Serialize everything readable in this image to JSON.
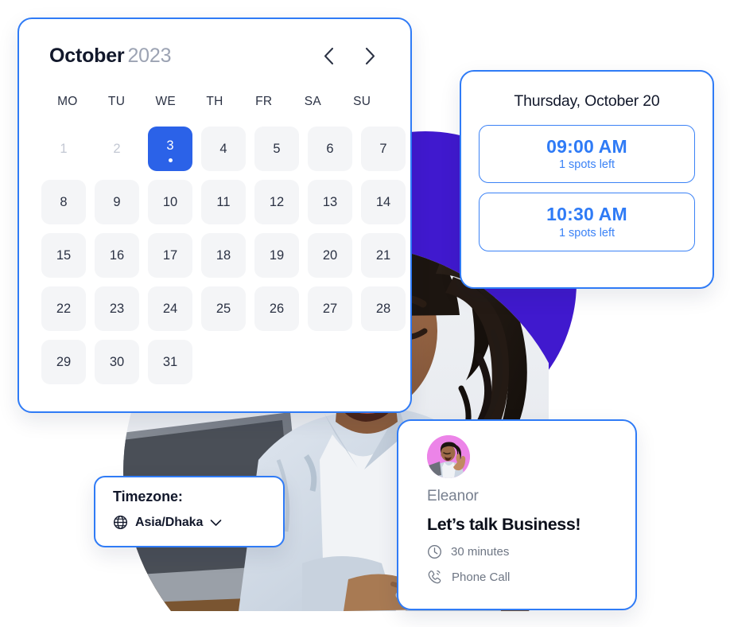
{
  "calendar": {
    "month": "October",
    "year": "2023",
    "prev_label": "chevron-left",
    "next_label": "chevron-right",
    "weekdays": [
      "MO",
      "TU",
      "WE",
      "TH",
      "FR",
      "SA",
      "SU"
    ],
    "days": [
      {
        "n": "1",
        "state": "muted"
      },
      {
        "n": "2",
        "state": "muted"
      },
      {
        "n": "3",
        "state": "selected",
        "dot": true
      },
      {
        "n": "4",
        "state": "normal"
      },
      {
        "n": "5",
        "state": "normal"
      },
      {
        "n": "6",
        "state": "normal"
      },
      {
        "n": "7",
        "state": "normal"
      },
      {
        "n": "8",
        "state": "normal"
      },
      {
        "n": "9",
        "state": "normal"
      },
      {
        "n": "10",
        "state": "normal"
      },
      {
        "n": "11",
        "state": "normal"
      },
      {
        "n": "12",
        "state": "normal"
      },
      {
        "n": "13",
        "state": "normal"
      },
      {
        "n": "14",
        "state": "normal"
      },
      {
        "n": "15",
        "state": "normal"
      },
      {
        "n": "16",
        "state": "normal"
      },
      {
        "n": "17",
        "state": "normal"
      },
      {
        "n": "18",
        "state": "normal"
      },
      {
        "n": "19",
        "state": "normal"
      },
      {
        "n": "20",
        "state": "normal"
      },
      {
        "n": "21",
        "state": "normal"
      },
      {
        "n": "22",
        "state": "normal"
      },
      {
        "n": "23",
        "state": "normal"
      },
      {
        "n": "24",
        "state": "normal"
      },
      {
        "n": "25",
        "state": "normal"
      },
      {
        "n": "26",
        "state": "normal"
      },
      {
        "n": "27",
        "state": "normal"
      },
      {
        "n": "28",
        "state": "normal"
      },
      {
        "n": "29",
        "state": "normal"
      },
      {
        "n": "30",
        "state": "normal"
      },
      {
        "n": "31",
        "state": "normal"
      }
    ]
  },
  "slots": {
    "date_heading": "Thursday, October 20",
    "items": [
      {
        "time": "09:00 AM",
        "availability": "1 spots left"
      },
      {
        "time": "10:30 AM",
        "availability": "1 spots left"
      }
    ]
  },
  "timezone": {
    "label": "Timezone:",
    "value": "Asia/Dhaka",
    "globe_icon": "globe-icon",
    "chevron_icon": "chevron-down-icon"
  },
  "meeting": {
    "host": "Eleanor",
    "title": "Let’s talk Business!",
    "duration": "30 minutes",
    "duration_icon": "clock-icon",
    "method": "Phone Call",
    "method_icon": "phone-call-icon",
    "avatar_name": "avatar"
  },
  "colors": {
    "primary_blue": "#2B62E8",
    "border_blue": "#2F7BF6",
    "slot_blue": "#3B82F6",
    "purple": "#4019CE",
    "avatar_pink": "#EC84E8",
    "tile_gray": "#F4F5F7",
    "text_dark": "#12182B",
    "text_muted": "#78808F"
  }
}
